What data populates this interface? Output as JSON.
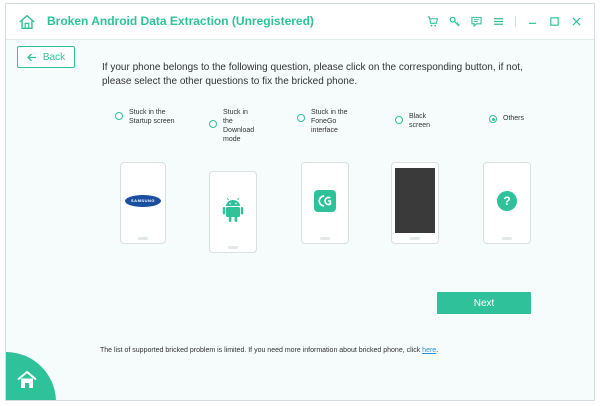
{
  "window": {
    "title": "Broken Android Data Extraction (Unregistered)",
    "accent": "#2fc29a",
    "toolbar_icons": [
      "cart-icon",
      "key-icon",
      "feedback-icon",
      "menu-icon",
      "minimize-icon",
      "maximize-icon",
      "close-icon"
    ]
  },
  "back_label": "Back",
  "instruction": "If your phone belongs to the following question, please click on the corresponding button, if not, please select the other questions to fix the bricked phone.",
  "options": [
    {
      "label": "Stuck in the Startup screen",
      "selected": false
    },
    {
      "label": "Stuck in the Download mode",
      "selected": false
    },
    {
      "label": "Stuck in the FoneGo interface",
      "selected": false
    },
    {
      "label": "Black screen",
      "selected": false
    },
    {
      "label": "Others",
      "selected": true
    }
  ],
  "phones": {
    "samsung_text": "SAMSUNG",
    "unknown_mark": "?"
  },
  "next_label": "Next",
  "footer": {
    "text": "The list of supported bricked problem is limited. If you need more information about bricked phone, click",
    "link": "here",
    "period": "."
  }
}
